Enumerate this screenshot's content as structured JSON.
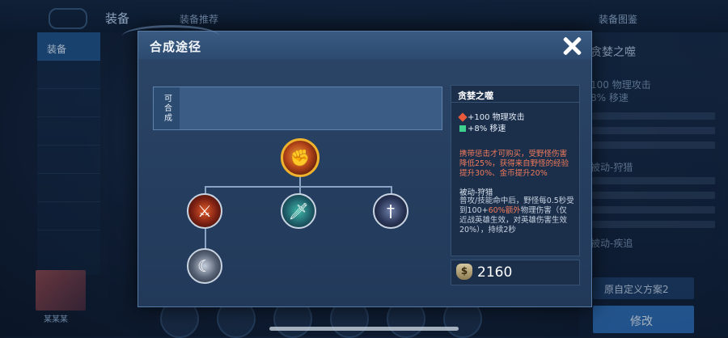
{
  "background": {
    "top_tab_equipment": "装备",
    "top_tab_secondary": "装备推荐",
    "top_right_label": "装备图鉴",
    "left_active_item": "装备",
    "right_item_name": "贪婪之噬",
    "right_stat_line": "100 物理攻击",
    "right_stat_line2": "8% 移速",
    "right_passive": "被动-狩猎",
    "right_passive2": "被动-疾追",
    "player_name": "某某某",
    "scheme_button": "原自定义方案2",
    "confirm_button": "修改"
  },
  "dialog": {
    "title": "合成途径",
    "close_icon": "close-icon"
  },
  "components": {
    "label": "可合成"
  },
  "tree": {
    "root_icon": "greedy-fang-icon",
    "children": [
      {
        "icon": "blade-icon"
      },
      {
        "icon": "sword-icon"
      },
      {
        "icon": "dagger-icon"
      }
    ],
    "grandchild_icon": "claw-icon"
  },
  "detail": {
    "name": "贪婪之噬",
    "stat1": "+100 物理攻击",
    "stat2": "+8% 移速",
    "note": "携带惩击才可购买，受野怪伤害降低25%，获得来自野怪的经验提升30%、金币提升20%",
    "passive_title": "被动-狩猎",
    "passive_before": "普攻/技能命中后，野怪每0.5秒受到100+",
    "passive_highlight": "60%额外",
    "passive_after": "物理伤害（仅近战英雄生效，对英雄伤害生效20%），持续2秒",
    "colors": {
      "note": "#f07a5a",
      "attack": "#e85a3a",
      "move": "#3fcf8e"
    }
  },
  "price": {
    "icon": "coin-bag-icon",
    "value": "2160"
  }
}
